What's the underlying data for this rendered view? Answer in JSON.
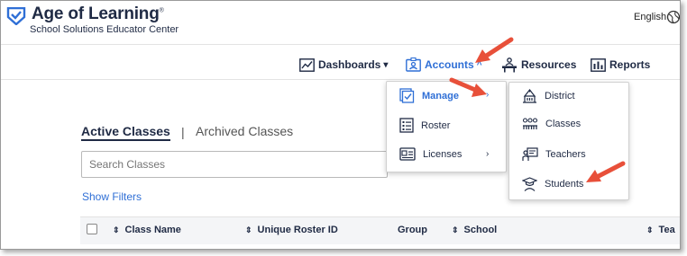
{
  "header": {
    "brand_title": "Age of Learning",
    "brand_reg": "®",
    "brand_subtitle": "School Solutions Educator Center",
    "language": "English",
    "logo_icon": "shield-check-logo",
    "language_icon": "globe-icon"
  },
  "nav": {
    "dashboards": "Dashboards",
    "dashboards_icon": "chart-icon",
    "accounts": "Accounts",
    "accounts_icon": "id-card-icon",
    "resources": "Resources",
    "resources_icon": "desk-icon",
    "reports": "Reports",
    "reports_icon": "bar-chart-icon",
    "caret_down": "▾",
    "caret_up": "^"
  },
  "tabs": {
    "active": "Active Classes",
    "separator": "|",
    "archived": "Archived Classes"
  },
  "search": {
    "placeholder": "Search Classes"
  },
  "filters": {
    "label": "Show Filters"
  },
  "table": {
    "sort_icon": "⇕",
    "columns": [
      "Class Name",
      "Unique Roster ID",
      "Group",
      "School",
      "Tea"
    ]
  },
  "accounts_menu": {
    "items": [
      {
        "label": "Manage",
        "icon": "manage-icon",
        "has_submenu": true
      },
      {
        "label": "Roster",
        "icon": "roster-icon",
        "has_submenu": false
      },
      {
        "label": "Licenses",
        "icon": "licenses-icon",
        "has_submenu": true
      }
    ],
    "submenu_chevron": "›"
  },
  "manage_submenu": {
    "items": [
      {
        "label": "District",
        "icon": "district-icon"
      },
      {
        "label": "Classes",
        "icon": "classes-icon"
      },
      {
        "label": "Teachers",
        "icon": "teachers-icon"
      },
      {
        "label": "Students",
        "icon": "students-icon"
      }
    ]
  },
  "colors": {
    "brand_navy": "#1f2a44",
    "accent_blue": "#2f6fd6",
    "callout_red": "#e8503a"
  }
}
